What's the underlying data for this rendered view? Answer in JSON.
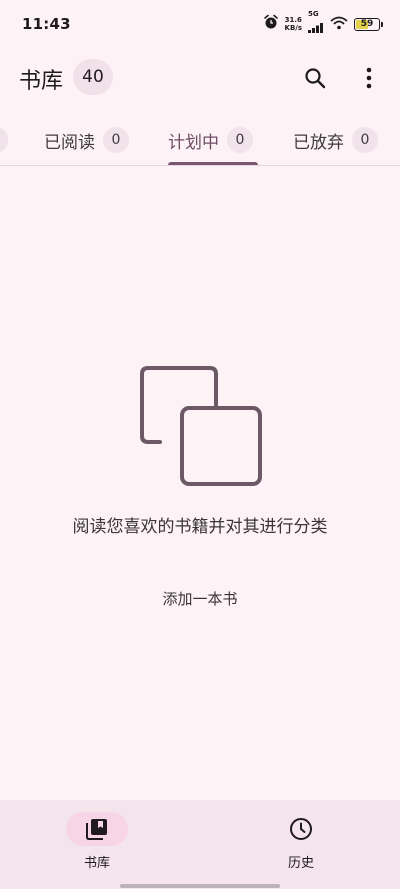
{
  "status_bar": {
    "time": "11:43",
    "net_speed_value": "31.6",
    "net_speed_unit": "KB/s",
    "signal_label": "5G",
    "battery": "59",
    "battery_level": 0.59
  },
  "app_bar": {
    "title": "书库",
    "count": "40",
    "search_icon": "search-icon",
    "more_icon": "more-vert-icon"
  },
  "tabs": [
    {
      "label": "",
      "count": "",
      "partial": true
    },
    {
      "label": "已阅读",
      "count": "0"
    },
    {
      "label": "计划中",
      "count": "0",
      "active": true
    },
    {
      "label": "已放弃",
      "count": "0"
    }
  ],
  "empty_state": {
    "icon": "copy-icon",
    "message": "阅读您喜欢的书籍并对其进行分类",
    "action_label": "添加一本书"
  },
  "bottom_nav": {
    "items": [
      {
        "label": "书库",
        "icon": "library-icon",
        "active": true
      },
      {
        "label": "历史",
        "icon": "history-icon",
        "active": false
      }
    ]
  },
  "colors": {
    "background": "#fdf3f7",
    "accent": "#7b5670",
    "nav_background": "#f4e4ec",
    "active_pill": "#f8d5e6"
  }
}
